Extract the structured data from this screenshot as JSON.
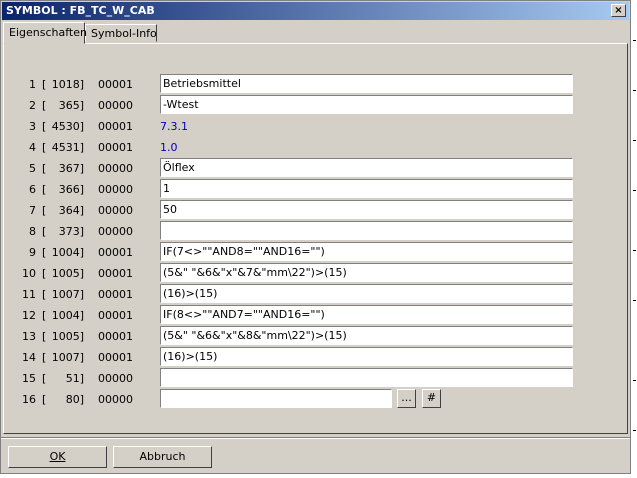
{
  "window": {
    "title": "SYMBOL : FB_TC_W_CAB",
    "close_glyph": "×"
  },
  "tabs": [
    {
      "label": "Eigenschaften",
      "active": true
    },
    {
      "label": "Symbol-Info",
      "active": false
    }
  ],
  "rows": [
    {
      "num": "1",
      "code": "1018]",
      "flag": "00001",
      "value": "Betriebsmittel",
      "kind": "input"
    },
    {
      "num": "2",
      "code": "365]",
      "flag": "00000",
      "value": "-Wtest",
      "kind": "input"
    },
    {
      "num": "3",
      "code": "4530]",
      "flag": "00001",
      "value": "7.3.1",
      "kind": "static"
    },
    {
      "num": "4",
      "code": "4531]",
      "flag": "00001",
      "value": "1.0",
      "kind": "static"
    },
    {
      "num": "5",
      "code": "367]",
      "flag": "00000",
      "value": "Ölflex",
      "kind": "input"
    },
    {
      "num": "6",
      "code": "366]",
      "flag": "00000",
      "value": "1",
      "kind": "input"
    },
    {
      "num": "7",
      "code": "364]",
      "flag": "00000",
      "value": "50",
      "kind": "input"
    },
    {
      "num": "8",
      "code": "373]",
      "flag": "00000",
      "value": "",
      "kind": "input"
    },
    {
      "num": "9",
      "code": "1004]",
      "flag": "00001",
      "value": "IF(7<>\"\"AND8=\"\"AND16=\"\")",
      "kind": "input"
    },
    {
      "num": "10",
      "code": "1005]",
      "flag": "00001",
      "value": "(5&\" \"&6&\"x\"&7&\"mm\\22\")>(15)",
      "kind": "input"
    },
    {
      "num": "11",
      "code": "1007]",
      "flag": "00001",
      "value": "(16)>(15)",
      "kind": "input"
    },
    {
      "num": "12",
      "code": "1004]",
      "flag": "00001",
      "value": "IF(8<>\"\"AND7=\"\"AND16=\"\")",
      "kind": "input"
    },
    {
      "num": "13",
      "code": "1005]",
      "flag": "00001",
      "value": "(5&\" \"&6&\"x\"&8&\"mm\\22\")>(15)",
      "kind": "input"
    },
    {
      "num": "14",
      "code": "1007]",
      "flag": "00001",
      "value": "(16)>(15)",
      "kind": "input"
    },
    {
      "num": "15",
      "code": "51]",
      "flag": "00000",
      "value": "",
      "kind": "input"
    },
    {
      "num": "16",
      "code": "80]",
      "flag": "00000",
      "value": "",
      "kind": "input-short"
    }
  ],
  "row_bracket": "[",
  "row16_buttons": {
    "browse_label": "...",
    "hash_label": "#"
  },
  "footer": {
    "ok_label": "OK",
    "cancel_label": "Abbruch"
  },
  "colors": {
    "titlebar_start": "#0a246a",
    "titlebar_end": "#a6caf0",
    "face": "#d4d0c8",
    "static_value": "#0000c0"
  }
}
